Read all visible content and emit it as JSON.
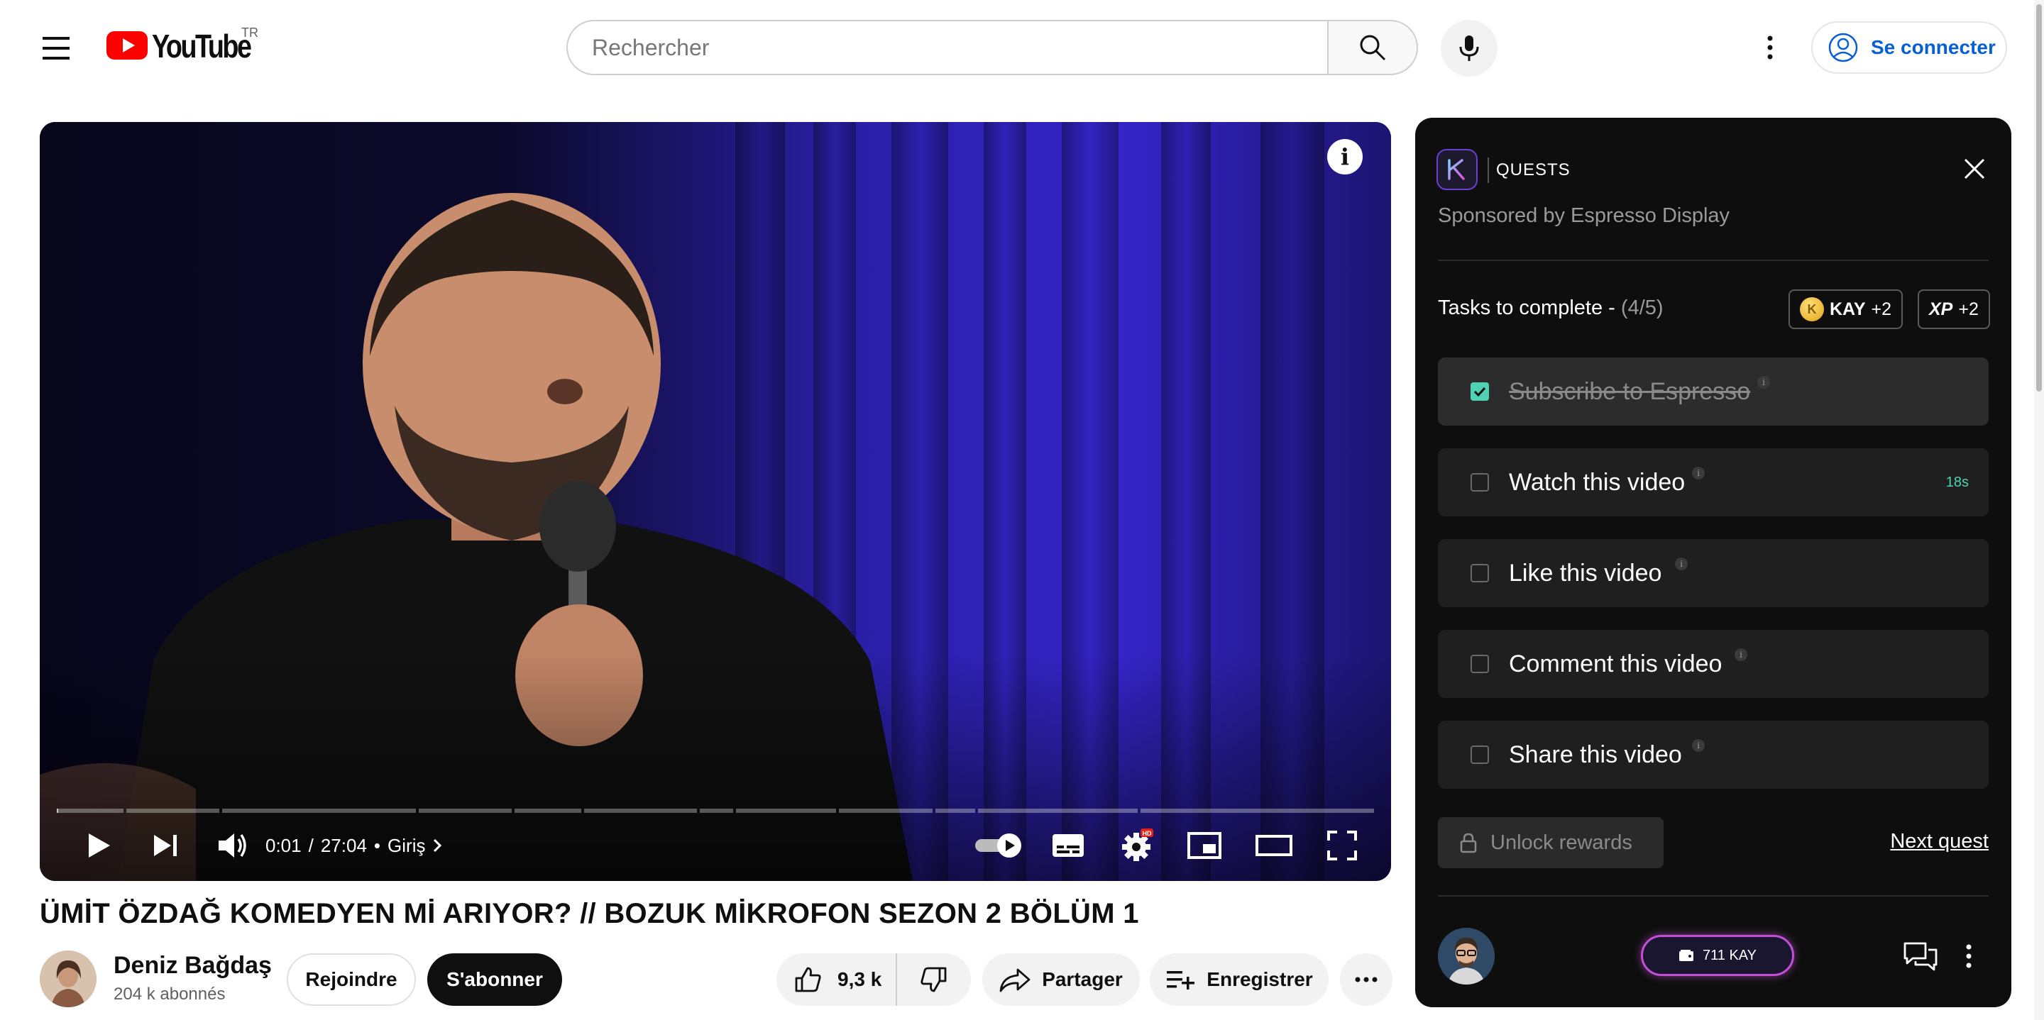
{
  "header": {
    "logo_text": "YouTube",
    "region": "TR",
    "search_placeholder": "Rechercher",
    "signin_label": "Se connecter"
  },
  "player": {
    "current_time": "0:01",
    "duration": "27:04",
    "time_separator": "/",
    "chapter_bullet": "•",
    "chapter": "Giriş",
    "played_fraction": 0.0006,
    "chapter_segments": [
      1,
      1.4,
      2.9,
      1.4,
      1.0,
      1.7,
      0.5,
      1.5,
      1.4,
      0.6,
      2.4,
      3.5
    ],
    "quality_badge": "HD",
    "info_glyph": "i",
    "autoplay_on": true
  },
  "video": {
    "title": "ÜMİT ÖZDAĞ KOMEDYEN Mİ ARIYOR? // BOZUK MİKROFON SEZON 2 BÖLÜM 1",
    "channel_name": "Deniz Bağdaş",
    "subscribers": "204 k abonnés",
    "join_label": "Rejoindre",
    "subscribe_label": "S'abonner",
    "likes": "9,3 k",
    "share_label": "Partager",
    "save_label": "Enregistrer"
  },
  "quests": {
    "title": "QUESTS",
    "sponsor": "Sponsored by Espresso Display",
    "tasks_heading": "Tasks to complete",
    "tasks_dash": "-",
    "tasks_count": "(4/5)",
    "reward_kay_name": "KAY",
    "reward_kay_value": "+2",
    "reward_xp_name": "XP",
    "reward_xp_value": "+2",
    "tooltip_glyph": "i",
    "tasks": [
      {
        "label": "Subscribe to Espresso",
        "done": true
      },
      {
        "label": "Watch this video",
        "done": false,
        "timer": "18s"
      },
      {
        "label": "Like this video",
        "done": false
      },
      {
        "label": "Comment this video",
        "done": false
      },
      {
        "label": "Share this video",
        "done": false
      }
    ],
    "unlock_label": "Unlock rewards",
    "next_label": "Next quest",
    "wallet_label": "711 KAY"
  },
  "colors": {
    "brand_red": "#ff0000",
    "link_blue": "#065fd4",
    "quest_accent": "#4fd1b5",
    "wallet_glow": "#c24fd6"
  }
}
